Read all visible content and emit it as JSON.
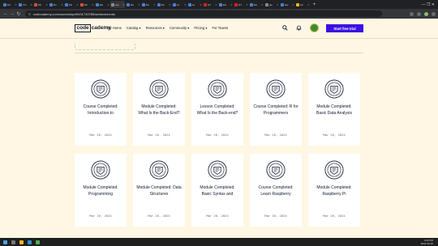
{
  "browser": {
    "tabs": [
      {
        "label": "Diz",
        "color": "#4a7fd6"
      },
      {
        "label": "Clo",
        "color": "#4a7fd6"
      },
      {
        "label": "Mo",
        "color": "#e04e39"
      },
      {
        "label": "Bu",
        "color": "#4a7fd6"
      },
      {
        "label": "Mo",
        "color": "#4a7fd6"
      },
      {
        "label": "Mo",
        "color": "#e04e39"
      },
      {
        "label": "EE",
        "color": "#4a7fd6"
      },
      {
        "label": "cap",
        "color": "#8a8a8a",
        "active": true
      },
      {
        "label": "Mo",
        "color": "#4a7fd6"
      },
      {
        "label": "Mo",
        "color": "#4a7fd6"
      },
      {
        "label": "Mo",
        "color": "#4a7fd6"
      },
      {
        "label": "Fo",
        "color": "#4a7fd6"
      },
      {
        "label": "Fe",
        "color": "#4a7fd6"
      },
      {
        "label": "(47",
        "color": "#e02020"
      },
      {
        "label": "Ele",
        "color": "#4a7fd6"
      },
      {
        "label": "(47",
        "color": "#e02020"
      },
      {
        "label": "Ele",
        "color": "#4a7fd6"
      },
      {
        "label": "gle",
        "color": "#8a8a8a"
      },
      {
        "label": "ady",
        "color": "#4a7fd6"
      },
      {
        "label": "Jia",
        "color": "#f2b61b"
      }
    ],
    "url": "codecademy.com/users/nktprt9491740789/achievements",
    "new_tab_symbol": "+",
    "window_controls": "—  ❐  ✕"
  },
  "header": {
    "logo_code": "code",
    "logo_rest": "cademy",
    "nav": [
      "My Home",
      "Catalog ▾",
      "Resources ▾",
      "Community ▾",
      "Pricing ▾",
      "For Teams"
    ],
    "cta": "Start free trial"
  },
  "cards": [
    {
      "title": "Course Completed: Introduction to",
      "date": "Mar 26, 2024"
    },
    {
      "title": "Module Completed: What Is the Back-End?",
      "date": "Mar 26, 2024"
    },
    {
      "title": "Lesson Completed: What Is the Back-end?",
      "date": "Mar 26, 2024"
    },
    {
      "title": "Course Completed: R for Programmers",
      "date": "Mar 26, 2024"
    },
    {
      "title": "Module Completed: Basic Data Analysis",
      "date": "Mar 26, 2024"
    },
    {
      "title": "Module Completed: Programming",
      "date": "Mar 26, 2024"
    },
    {
      "title": "Module Completed: Data Structures",
      "date": "Mar 26, 2024"
    },
    {
      "title": "Module Completed: Basic Syntax and",
      "date": "Mar 26, 2024"
    },
    {
      "title": "Course Completed: Learn Raspberry",
      "date": "Mar 26, 2024"
    },
    {
      "title": "Module Completed: Raspberry Pi",
      "date": "Mar 26, 2024"
    }
  ],
  "badge": {
    "top_text": "CODE",
    "bottom_text": "ACADEMY"
  },
  "taskbar": {
    "time": "4:20 PM",
    "date": "2024-03-26"
  },
  "colors": {
    "page_bg": "#fff7e3",
    "cta": "#3a10e5",
    "ink": "#10162f"
  }
}
